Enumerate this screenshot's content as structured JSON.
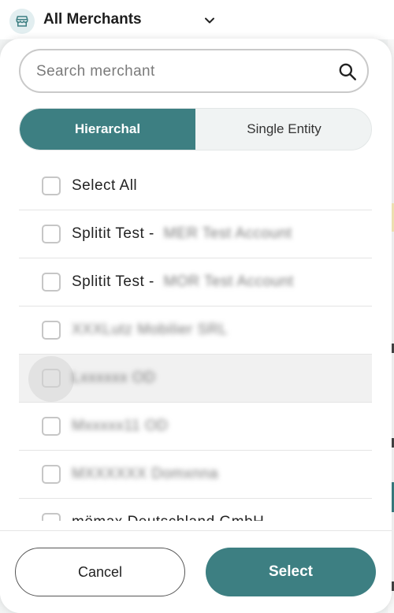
{
  "header": {
    "title": "All Merchants",
    "store_icon": "store-icon",
    "chevron_icon": "chevron-down-icon"
  },
  "search": {
    "placeholder": "Search merchant",
    "value": "",
    "icon": "search-icon"
  },
  "view_toggle": {
    "options": [
      {
        "label": "Hierarchal",
        "selected": true
      },
      {
        "label": "Single Entity",
        "selected": false
      }
    ]
  },
  "list": {
    "items": [
      {
        "label": "Select All",
        "obscured": ""
      },
      {
        "label": "Splitit Test - ",
        "obscured": "MER Test Account"
      },
      {
        "label": "Splitit Test - ",
        "obscured": "MOR Test Account"
      },
      {
        "label": "",
        "obscured": "XXXLutz Mobilier SRL"
      },
      {
        "label": "",
        "obscured": "Lxxxxxx OD"
      },
      {
        "label": "",
        "obscured": "Mxxxxx11 OD"
      },
      {
        "label": "",
        "obscured": "MXXXXXX Domxnna"
      },
      {
        "label": "mömax Deutschland GmbH",
        "obscured": ""
      }
    ]
  },
  "footer": {
    "cancel_label": "Cancel",
    "select_label": "Select"
  },
  "colors": {
    "accent": "#3d7f82",
    "toggle_bg": "#f0f3f3",
    "border": "#c9c9c9"
  }
}
